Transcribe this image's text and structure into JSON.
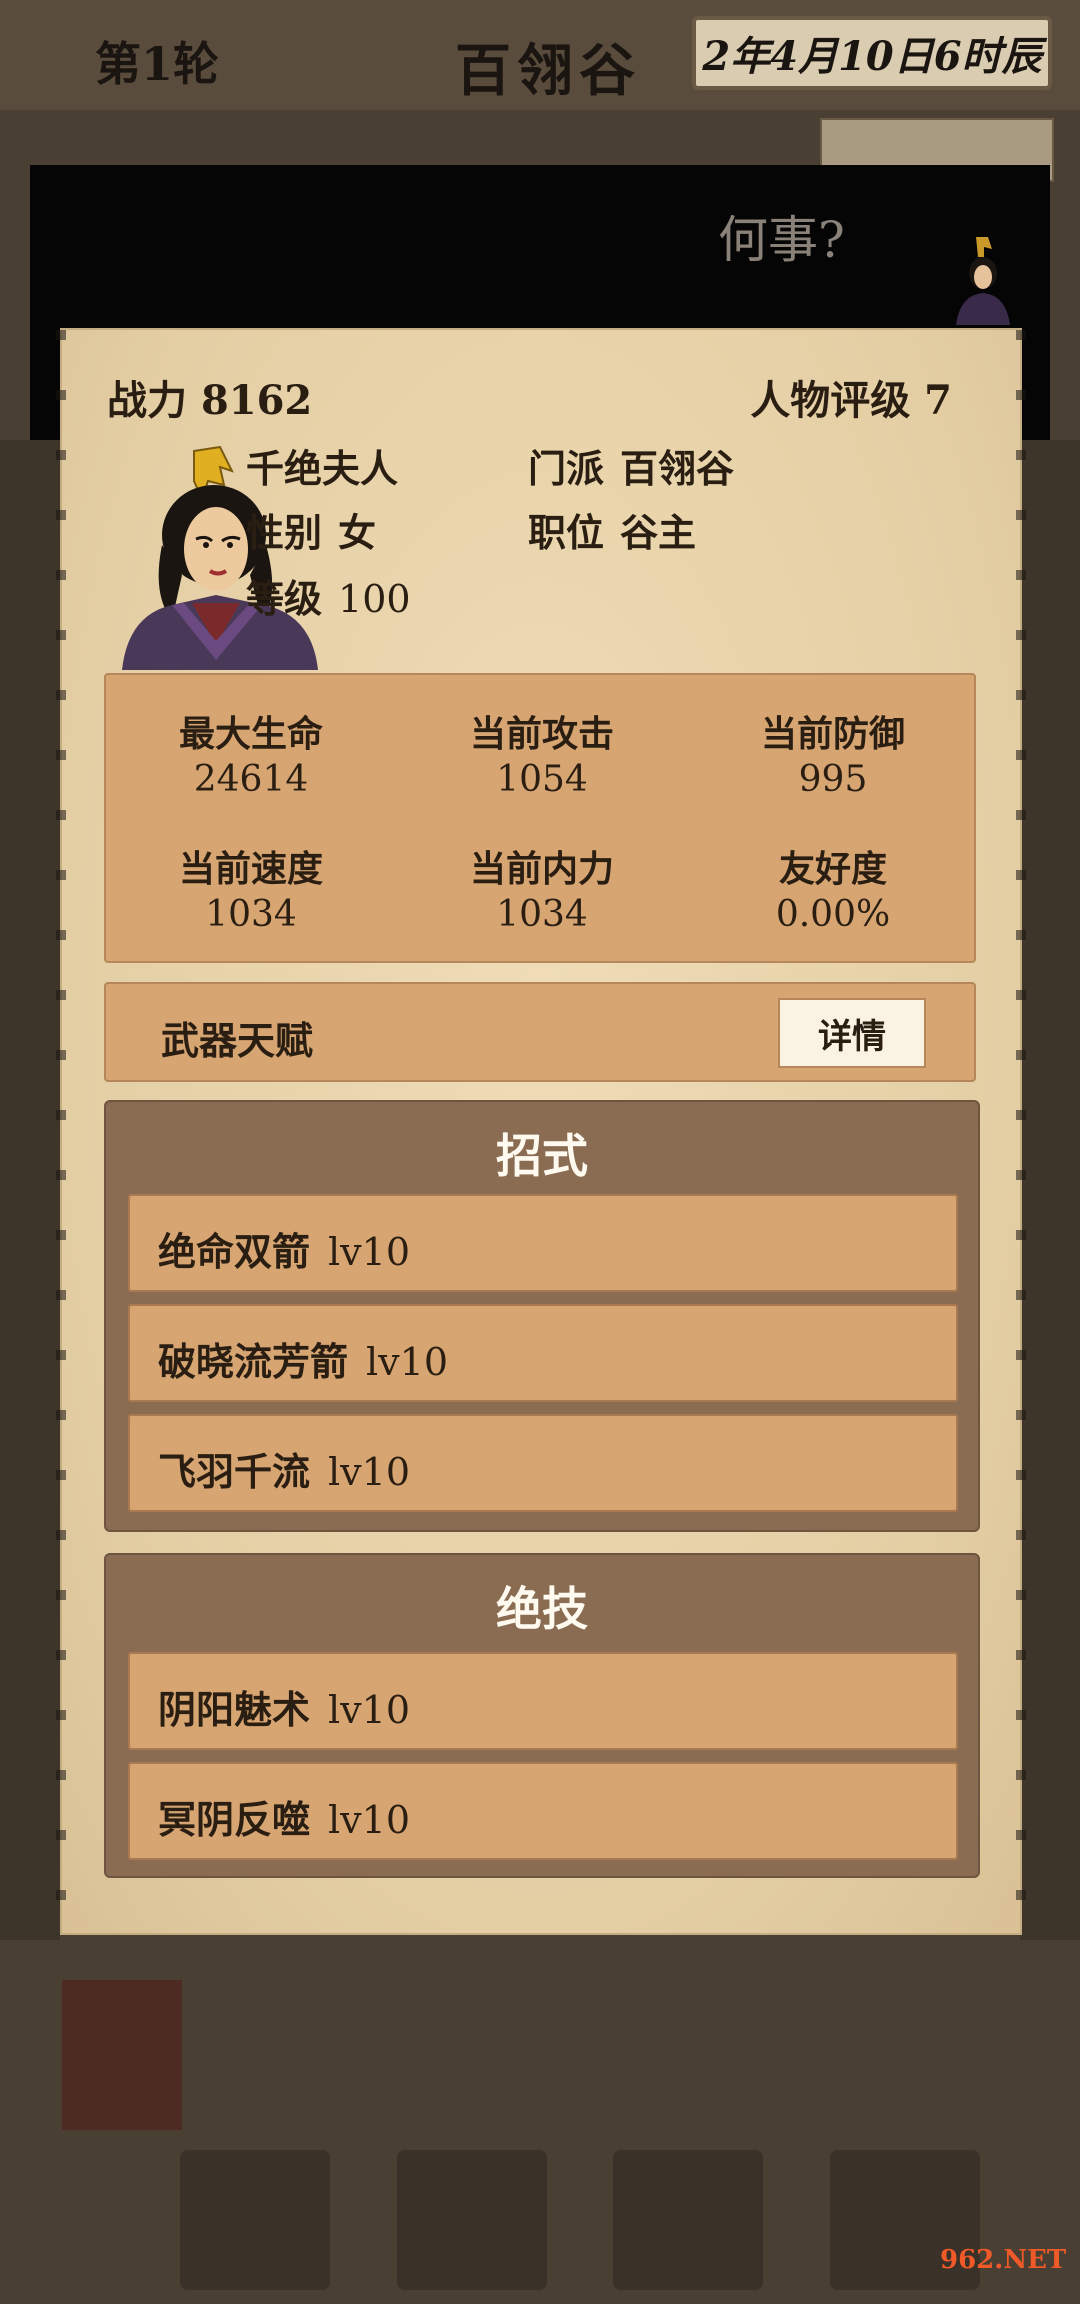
{
  "background": {
    "round_label": "第1轮",
    "location_title": "百翎谷",
    "date": "2年4月10日6时辰",
    "dialog_text": "何事?",
    "watermark": "962.NET"
  },
  "character": {
    "power_label": "战力",
    "power_value": "8162",
    "rating_label": "人物评级",
    "rating_value": "7",
    "name": "千绝夫人",
    "sect_label": "门派",
    "sect_value": "百翎谷",
    "gender_label": "性别",
    "gender_value": "女",
    "position_label": "职位",
    "position_value": "谷主",
    "level_label": "等级",
    "level_value": "100"
  },
  "stats": [
    {
      "label": "最大生命",
      "value": "24614"
    },
    {
      "label": "当前攻击",
      "value": "1054"
    },
    {
      "label": "当前防御",
      "value": "995"
    },
    {
      "label": "当前速度",
      "value": "1034"
    },
    {
      "label": "当前内力",
      "value": "1034"
    },
    {
      "label": "友好度",
      "value": "0.00%"
    }
  ],
  "talent": {
    "label": "武器天赋",
    "button": "详情"
  },
  "moves": {
    "title": "招式",
    "items": [
      {
        "name": "绝命双箭",
        "level": "lv10"
      },
      {
        "name": "破晓流芳箭",
        "level": "lv10"
      },
      {
        "name": "飞羽千流",
        "level": "lv10"
      }
    ]
  },
  "ultimates": {
    "title": "绝技",
    "items": [
      {
        "name": "阴阳魅术",
        "level": "lv10"
      },
      {
        "name": "冥阴反噬",
        "level": "lv10"
      }
    ]
  }
}
